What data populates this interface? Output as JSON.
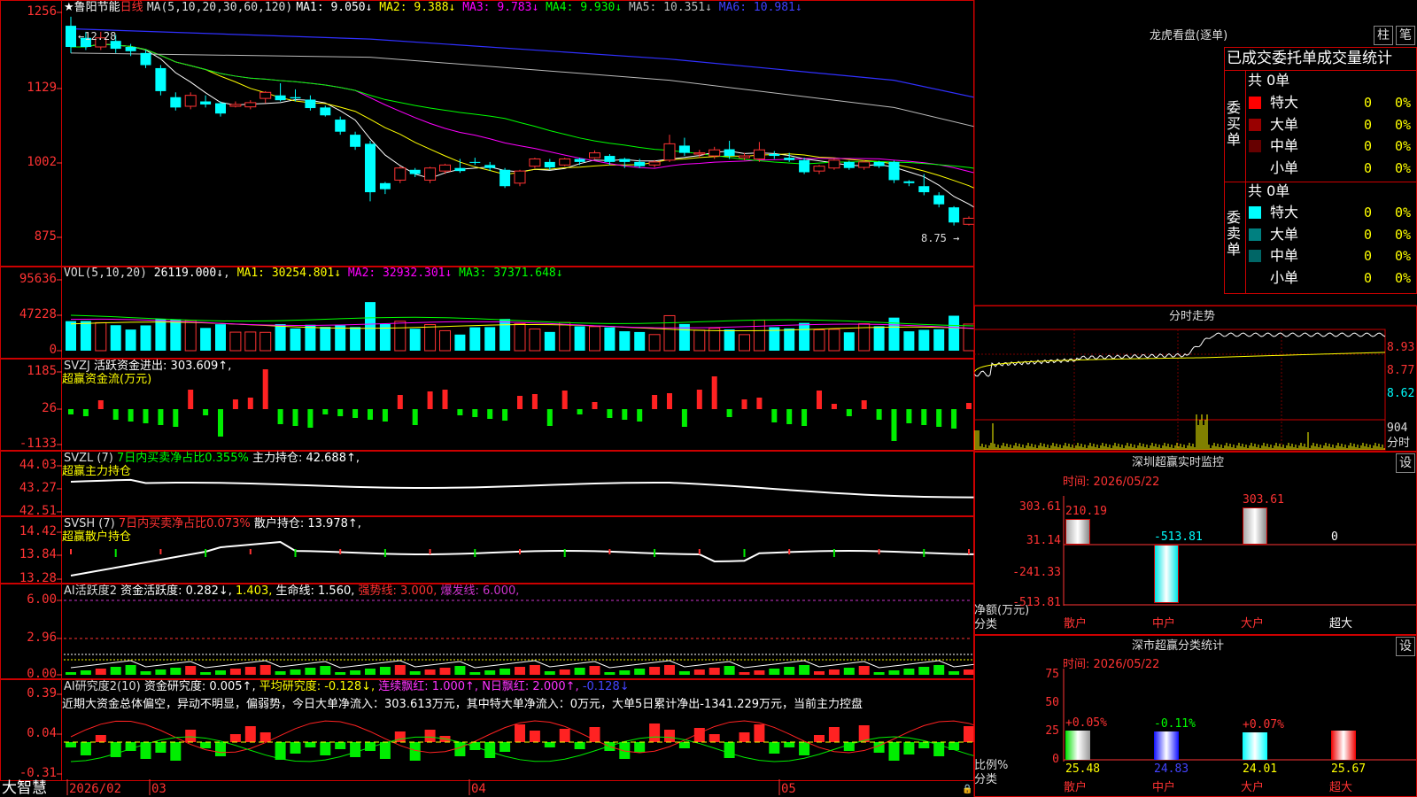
{
  "kline": {
    "stock_name": "鲁阳节能",
    "period": "日线",
    "ma_label": "MA(5,10,20,30,60,120)",
    "ma_values": [
      {
        "label": "MA1: 9.050↓",
        "color": "#ffffff"
      },
      {
        "label": "MA2: 9.388↓",
        "color": "#ffff00"
      },
      {
        "label": "MA3: 9.783↓",
        "color": "#ff00ff"
      },
      {
        "label": "MA4: 9.930↓",
        "color": "#00ff00"
      },
      {
        "label": "MA5: 10.351↓",
        "color": "#bbbbbb"
      },
      {
        "label": "MA6: 10.981↓",
        "color": "#4040ff"
      }
    ],
    "y_ticks": [
      "1256",
      "1129",
      "1002",
      "875"
    ],
    "high_label": "12.28",
    "last_price_label": "8.75"
  },
  "vol": {
    "label": "VOL(5,10,20)",
    "value": "26119.000↓",
    "ma_values": [
      {
        "label": "MA1: 30254.801↓",
        "color": "#ffff00"
      },
      {
        "label": "MA2: 32932.301↓",
        "color": "#ff00ff"
      },
      {
        "label": "MA3: 37371.648↓",
        "color": "#00ff00"
      }
    ],
    "y_ticks": [
      "95636",
      "47228",
      "0"
    ]
  },
  "svzj": {
    "label": "SVZJ",
    "active": "活跃资金进出: 303.609↑,",
    "title2": "超赢资金流(万元)",
    "y_ticks": [
      "1185",
      "26",
      "-1133"
    ]
  },
  "svzl": {
    "label": "SVZL (7)",
    "ratio": "7日内买卖净占比0.355%",
    "hold": "主力持仓: 42.688↑,",
    "title2": "超赢主力持仓",
    "y_ticks": [
      "44.03",
      "43.27",
      "42.51"
    ]
  },
  "svsh": {
    "label": "SVSH (7)",
    "ratio": "7日内买卖净占比0.073%",
    "hold": "散户持仓: 13.978↑,",
    "title2": "超赢散户持仓",
    "y_ticks": [
      "14.42",
      "13.84",
      "13.28"
    ]
  },
  "ai1": {
    "label": "AI活跃度2",
    "parts": [
      {
        "t": "资金活跃度: 0.282↓,",
        "c": "#ffffff"
      },
      {
        "t": "1.403,",
        "c": "#ffff00"
      },
      {
        "t": "生命线: 1.560,",
        "c": "#ffffff"
      },
      {
        "t": "强势线: 3.000,",
        "c": "#ff3333"
      },
      {
        "t": "爆发线: 6.000,",
        "c": "#cc33cc"
      }
    ],
    "y_ticks": [
      "6.00",
      "2.96",
      "0.00"
    ]
  },
  "ai2": {
    "label": "AI研究度2(10)",
    "parts": [
      {
        "t": "资金研究度: 0.005↑,",
        "c": "#ffffff"
      },
      {
        "t": "平均研究度: -0.128↓,",
        "c": "#ffff00"
      },
      {
        "t": "连续飘红: 1.000↑,",
        "c": "#ff33ff"
      },
      {
        "t": "N日飘红: 2.000↑,",
        "c": "#ff33ff"
      },
      {
        "t": "-0.128↓",
        "c": "#4444ff"
      }
    ],
    "comment": "近期大资金总体偏空，异动不明显，偏弱势，今日大单净流入：303.613万元，其中特大单净流入：0万元，大单5日累计净出-1341.229万元，当前主力控盘",
    "y_ticks": [
      "0.39",
      "0.04",
      "-0.31"
    ]
  },
  "bottom": {
    "brand": "大智慧",
    "dates": [
      "2026/02",
      "03",
      "04",
      "05"
    ]
  },
  "lhb": {
    "title": "龙虎看盘(逐单)",
    "btn_bar": "柱",
    "btn_pen": "笔",
    "header": "已成交委托单成交量统计",
    "buy_side": "委买单",
    "sell_side": "委卖单",
    "buy_total": "共 0单",
    "sell_total": "共 0单",
    "buy_rows": [
      {
        "name": "特大",
        "color": "#ff0000",
        "qty": "0",
        "pct": "0%"
      },
      {
        "name": "大单",
        "color": "#990000",
        "qty": "0",
        "pct": "0%"
      },
      {
        "name": "中单",
        "color": "#660000",
        "qty": "0",
        "pct": "0%"
      },
      {
        "name": "小单",
        "color": "",
        "qty": "0",
        "pct": "0%"
      }
    ],
    "sell_rows": [
      {
        "name": "特大",
        "color": "#00ffff",
        "qty": "0",
        "pct": "0%"
      },
      {
        "name": "大单",
        "color": "#008080",
        "qty": "0",
        "pct": "0%"
      },
      {
        "name": "中单",
        "color": "#006666",
        "qty": "0",
        "pct": "0%"
      },
      {
        "name": "小单",
        "color": "",
        "qty": "0",
        "pct": "0%"
      }
    ]
  },
  "intraday": {
    "title": "分时走势",
    "y_ticks": [
      "8.93",
      "8.77",
      "8.62"
    ],
    "vol_tick": "904",
    "vol_label": "分时"
  },
  "monitor": {
    "title": "深圳超赢实时监控",
    "btn": "设",
    "time": "时间: 2026/05/22",
    "y_ticks": [
      "303.61",
      "31.14",
      "-241.33",
      "-513.81"
    ],
    "axis_label": "净额(万元)",
    "axis_sub": "分类",
    "bars": [
      {
        "cat": "散户",
        "value": 210.19,
        "label": "210.19",
        "kind": "white",
        "labelColor": "#ff3333"
      },
      {
        "cat": "中户",
        "value": -513.81,
        "label": "-513.81",
        "kind": "cyan",
        "labelColor": "#00ffff"
      },
      {
        "cat": "大户",
        "value": 303.61,
        "label": "303.61",
        "kind": "white",
        "labelColor": "#ff3333"
      },
      {
        "cat": "超大",
        "value": 0,
        "label": "0",
        "kind": "none",
        "labelColor": "#ffffff"
      }
    ]
  },
  "classify": {
    "title": "深市超赢分类统计",
    "btn": "设",
    "time": "时间: 2026/05/22",
    "y_ticks": [
      "75",
      "50",
      "25",
      "0"
    ],
    "axis_label": "比例%",
    "axis_sub": "分类",
    "bars": [
      {
        "cat": "散户",
        "value": 25.48,
        "label": "25.48",
        "delta": "+0.05%",
        "deltaColor": "#ff3333",
        "valColor": "#ffff00",
        "kind": "green"
      },
      {
        "cat": "中户",
        "value": 24.83,
        "label": "24.83",
        "delta": "-0.11%",
        "deltaColor": "#00ff00",
        "valColor": "#4444ff",
        "kind": "blue"
      },
      {
        "cat": "大户",
        "value": 24.01,
        "label": "24.01",
        "delta": "+0.07%",
        "deltaColor": "#ff3333",
        "valColor": "#ffff00",
        "kind": "cyan"
      },
      {
        "cat": "超大",
        "value": 25.67,
        "label": "25.67",
        "delta": "",
        "deltaColor": "#ff3333",
        "valColor": "#ffff00",
        "kind": "red"
      }
    ]
  },
  "candles": [
    {
      "o": 12.3,
      "c": 11.95,
      "h": 12.45,
      "l": 11.85
    },
    {
      "o": 12.1,
      "c": 11.95,
      "h": 12.2,
      "l": 11.9
    },
    {
      "o": 11.95,
      "c": 12.1,
      "h": 12.2,
      "l": 11.9
    },
    {
      "o": 12.05,
      "c": 11.92,
      "h": 12.15,
      "l": 11.85
    },
    {
      "o": 11.95,
      "c": 11.88,
      "h": 12.0,
      "l": 11.8
    },
    {
      "o": 11.85,
      "c": 11.65,
      "h": 11.9,
      "l": 11.6
    },
    {
      "o": 11.6,
      "c": 11.22,
      "h": 11.65,
      "l": 11.15
    },
    {
      "o": 11.12,
      "c": 10.95,
      "h": 11.2,
      "l": 10.9
    },
    {
      "o": 10.97,
      "c": 11.15,
      "h": 11.2,
      "l": 10.92
    },
    {
      "o": 11.05,
      "c": 11.0,
      "h": 11.15,
      "l": 10.95
    },
    {
      "o": 11.02,
      "c": 10.85,
      "h": 11.05,
      "l": 10.8
    },
    {
      "o": 10.97,
      "c": 11.0,
      "h": 11.05,
      "l": 10.95
    },
    {
      "o": 10.96,
      "c": 11.03,
      "h": 11.07,
      "l": 10.92
    },
    {
      "o": 11.1,
      "c": 11.2,
      "h": 11.22,
      "l": 11.02
    },
    {
      "o": 11.15,
      "c": 11.07,
      "h": 11.35,
      "l": 11.05
    },
    {
      "o": 11.12,
      "c": 11.1,
      "h": 11.25,
      "l": 11.05
    },
    {
      "o": 11.08,
      "c": 10.94,
      "h": 11.15,
      "l": 10.9
    },
    {
      "o": 10.95,
      "c": 10.82,
      "h": 10.98,
      "l": 10.8
    },
    {
      "o": 10.75,
      "c": 10.55,
      "h": 10.8,
      "l": 10.5
    },
    {
      "o": 10.5,
      "c": 10.3,
      "h": 10.55,
      "l": 10.25
    },
    {
      "o": 10.35,
      "c": 9.55,
      "h": 10.4,
      "l": 9.4
    },
    {
      "o": 9.7,
      "c": 9.6,
      "h": 9.72,
      "l": 9.52
    },
    {
      "o": 9.75,
      "c": 9.95,
      "h": 9.98,
      "l": 9.7
    },
    {
      "o": 9.92,
      "c": 9.85,
      "h": 9.95,
      "l": 9.8
    },
    {
      "o": 9.75,
      "c": 9.95,
      "h": 9.97,
      "l": 9.7
    },
    {
      "o": 9.9,
      "c": 10.0,
      "h": 10.02,
      "l": 9.85
    },
    {
      "o": 9.95,
      "c": 9.9,
      "h": 10.1,
      "l": 9.87
    },
    {
      "o": 10.05,
      "c": 10.04,
      "h": 10.12,
      "l": 10.0
    },
    {
      "o": 10.0,
      "c": 9.95,
      "h": 10.05,
      "l": 9.9
    },
    {
      "o": 9.92,
      "c": 9.65,
      "h": 9.95,
      "l": 9.62
    },
    {
      "o": 9.7,
      "c": 9.9,
      "h": 9.92,
      "l": 9.65
    },
    {
      "o": 9.98,
      "c": 10.1,
      "h": 10.12,
      "l": 9.95
    },
    {
      "o": 10.05,
      "c": 9.96,
      "h": 10.1,
      "l": 9.92
    },
    {
      "o": 10.0,
      "c": 10.1,
      "h": 10.12,
      "l": 9.98
    },
    {
      "o": 10.1,
      "c": 10.05,
      "h": 10.12,
      "l": 10.0
    },
    {
      "o": 10.12,
      "c": 10.2,
      "h": 10.24,
      "l": 10.1
    },
    {
      "o": 10.15,
      "c": 10.05,
      "h": 10.18,
      "l": 10.0
    },
    {
      "o": 10.1,
      "c": 10.05,
      "h": 10.12,
      "l": 9.95
    },
    {
      "o": 10.05,
      "c": 9.98,
      "h": 10.1,
      "l": 9.95
    },
    {
      "o": 10.0,
      "c": 10.05,
      "h": 10.08,
      "l": 9.96
    },
    {
      "o": 10.08,
      "c": 10.35,
      "h": 10.5,
      "l": 10.05
    },
    {
      "o": 10.32,
      "c": 10.2,
      "h": 10.45,
      "l": 10.15
    },
    {
      "o": 10.18,
      "c": 10.2,
      "h": 10.25,
      "l": 10.12
    },
    {
      "o": 10.15,
      "c": 10.25,
      "h": 10.3,
      "l": 10.1
    },
    {
      "o": 10.26,
      "c": 10.15,
      "h": 10.4,
      "l": 10.1
    },
    {
      "o": 10.12,
      "c": 10.15,
      "h": 10.2,
      "l": 10.08
    },
    {
      "o": 10.1,
      "c": 10.25,
      "h": 10.38,
      "l": 10.05
    },
    {
      "o": 10.18,
      "c": 10.15,
      "h": 10.23,
      "l": 10.1
    },
    {
      "o": 10.12,
      "c": 10.08,
      "h": 10.2,
      "l": 10.05
    },
    {
      "o": 10.08,
      "c": 9.88,
      "h": 10.12,
      "l": 9.85
    },
    {
      "o": 9.9,
      "c": 9.98,
      "h": 10.0,
      "l": 9.85
    },
    {
      "o": 9.95,
      "c": 10.08,
      "h": 10.1,
      "l": 9.92
    },
    {
      "o": 10.05,
      "c": 9.95,
      "h": 10.07,
      "l": 9.92
    },
    {
      "o": 9.96,
      "c": 10.05,
      "h": 10.08,
      "l": 9.92
    },
    {
      "o": 10.05,
      "c": 9.98,
      "h": 10.07,
      "l": 9.95
    },
    {
      "o": 10.05,
      "c": 9.75,
      "h": 10.07,
      "l": 9.7
    },
    {
      "o": 9.73,
      "c": 9.7,
      "h": 9.75,
      "l": 9.65
    },
    {
      "o": 9.65,
      "c": 9.55,
      "h": 9.85,
      "l": 9.5
    },
    {
      "o": 9.5,
      "c": 9.35,
      "h": 9.55,
      "l": 9.3
    },
    {
      "o": 9.3,
      "c": 9.05,
      "h": 9.32,
      "l": 9.0
    },
    {
      "o": 9.02,
      "c": 9.12,
      "h": 9.15,
      "l": 9.0
    },
    {
      "o": 9.05,
      "c": 8.95,
      "h": 9.1,
      "l": 8.9
    },
    {
      "o": 8.95,
      "c": 8.75,
      "h": 9.0,
      "l": 8.72
    },
    {
      "o": 8.78,
      "c": 8.95,
      "h": 8.98,
      "l": 8.75
    }
  ]
}
